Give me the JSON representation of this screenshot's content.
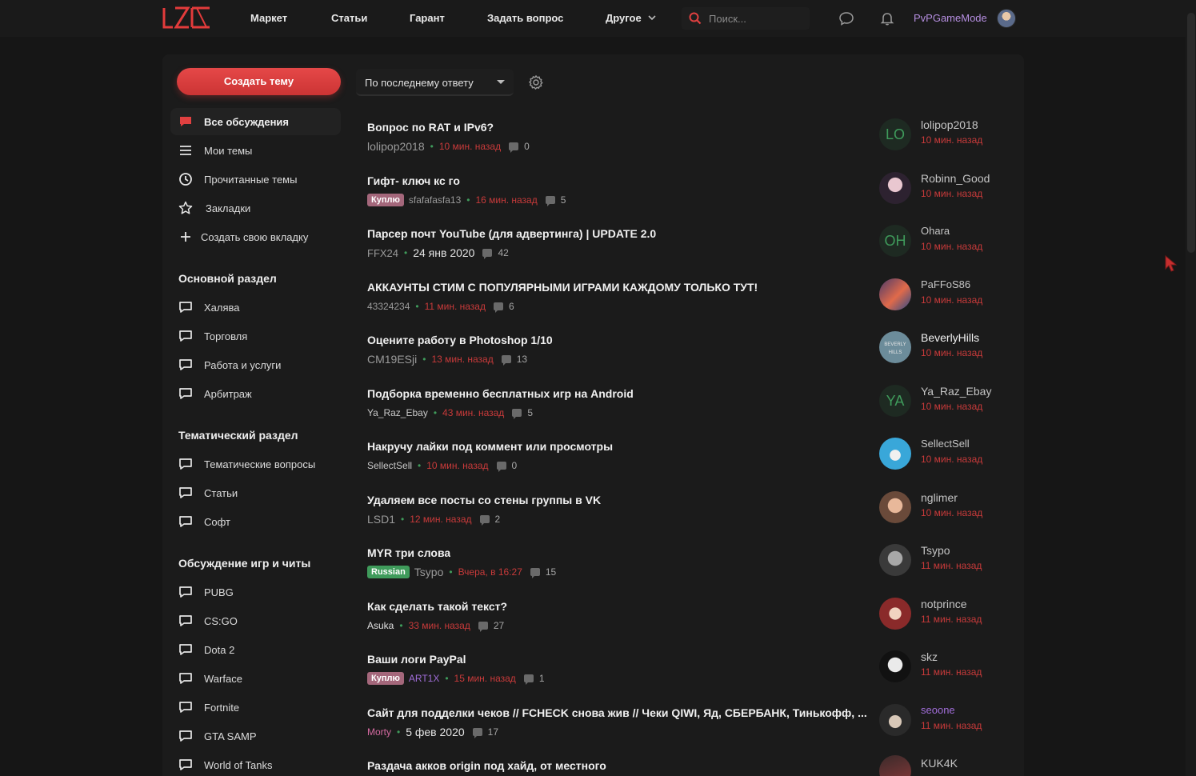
{
  "header": {
    "nav": [
      {
        "label": "Маркет"
      },
      {
        "label": "Статьи"
      },
      {
        "label": "Гарант"
      },
      {
        "label": "Задать вопрос"
      },
      {
        "label": "Другое"
      }
    ],
    "search_placeholder": "Поиск...",
    "username": "PvPGameMode"
  },
  "sidebar": {
    "create_button": "Создать тему",
    "main_items": [
      {
        "label": "Все обсуждения",
        "icon": "chat-filled-icon"
      },
      {
        "label": "Мои темы",
        "icon": "list-icon"
      },
      {
        "label": "Прочитанные темы",
        "icon": "clock-icon"
      },
      {
        "label": "Закладки",
        "icon": "star-icon"
      },
      {
        "label": "Создать свою вкладку",
        "icon": "plus-icon"
      }
    ],
    "sections": [
      {
        "heading": "Основной раздел",
        "items": [
          "Халява",
          "Торговля",
          "Работа и услуги",
          "Арбитраж"
        ]
      },
      {
        "heading": "Тематический раздел",
        "items": [
          "Тематические вопросы",
          "Статьи",
          "Софт"
        ]
      },
      {
        "heading": "Обсуждение игр и читы",
        "items": [
          "PUBG",
          "CS:GO",
          "Dota 2",
          "Warface",
          "Fortnite",
          "GTA SAMP",
          "World of Tanks"
        ]
      }
    ]
  },
  "sort": {
    "label": "По последнему ответу"
  },
  "colors": {
    "accent": "#e04040",
    "background": "#161616",
    "card": "#1b1b1b",
    "dot": "#3f9b5b",
    "time": "#c83a3a"
  },
  "threads": [
    {
      "title": "Вопрос по RAT и IPv6?",
      "author": "lolipop2018",
      "time": "10 мин. назад",
      "replies": "0",
      "last_user": "lolipop2018",
      "last_time": "10 мин. назад",
      "avatar_text": "LO"
    },
    {
      "title": "Гифт- ключ кс го",
      "prefix": "Куплю",
      "author": "sfafafasfa13",
      "time": "16 мин. назад",
      "replies": "5",
      "last_user": "Robinn_Good",
      "last_time": "10 мин. назад"
    },
    {
      "title": "Парсер почт YouTube (для адвертинга) | UPDATE 2.0",
      "author": "FFX24",
      "date": "24 янв 2020",
      "replies": "42",
      "last_user": "Ohara",
      "last_time": "10 мин. назад",
      "avatar_text": "OH"
    },
    {
      "title": "АККАУНТЫ СТИМ С ПОПУЛЯРНЫМИ ИГРАМИ КАЖДОМУ ТОЛЬКО ТУТ!",
      "author": "43324234",
      "time": "11 мин. назад",
      "replies": "6",
      "last_user": "PaFFoS86",
      "last_time": "10 мин. назад"
    },
    {
      "title": "Оцените работу в Photoshop 1/10",
      "author": "CM19ESji",
      "time": "13 мин. назад",
      "replies": "13",
      "last_user": "BeverlyHills",
      "last_time": "10 мин. назад",
      "avatar_text": "BEVERLY HILLS"
    },
    {
      "title": "Подборка временно бесплатных игр на Android",
      "author": "Ya_Raz_Ebay",
      "time": "43 мин. назад",
      "replies": "5",
      "last_user": "Ya_Raz_Ebay",
      "last_time": "10 мин. назад",
      "avatar_text": "YA"
    },
    {
      "title": "Накручу лайки под коммент или просмотры",
      "author": "SellectSell",
      "time": "10 мин. назад",
      "replies": "0",
      "last_user": "SellectSell",
      "last_time": "10 мин. назад"
    },
    {
      "title": "Удаляем все посты со стены группы в VK",
      "author": "LSD1",
      "time": "12 мин. назад",
      "replies": "2",
      "last_user": "nglimer",
      "last_time": "10 мин. назад"
    },
    {
      "title": "MYR три слова",
      "prefix": "Russian",
      "author": "Tsypo",
      "time": "Вчера, в 16:27",
      "replies": "15",
      "last_user": "Tsypo",
      "last_time": "11 мин. назад"
    },
    {
      "title": "Как сделать такой текст?",
      "author": "Asuka",
      "time": "33 мин. назад",
      "replies": "27",
      "last_user": "notprince",
      "last_time": "11 мин. назад"
    },
    {
      "title": "Ваши логи PayPal",
      "prefix": "Куплю",
      "author": "ART1X",
      "time": "15 мин. назад",
      "replies": "1",
      "last_user": "skz",
      "last_time": "11 мин. назад"
    },
    {
      "title": "Сайт для подделки чеков // FCHECK снова жив // Чеки QIWI, Яд, СБЕРБАНК, Тинькофф, ...",
      "author": "Morty",
      "date": "5 фев 2020",
      "replies": "17",
      "last_user": "seoone",
      "last_time": "11 мин. назад"
    },
    {
      "title": "Раздача акков origin под хайд, от местного",
      "last_user": "KUK4K"
    }
  ]
}
